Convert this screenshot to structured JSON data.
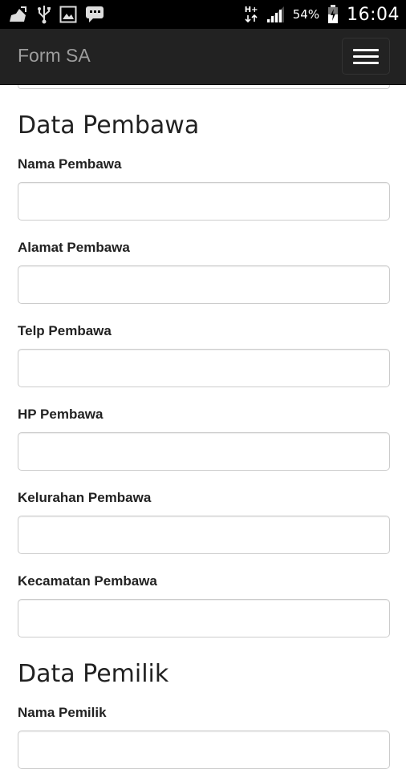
{
  "status_bar": {
    "network_type": "H+",
    "battery_percent": "54%",
    "time": "16:04"
  },
  "navbar": {
    "brand": "Form SA"
  },
  "sections": [
    {
      "title": "Data Pembawa",
      "fields": [
        {
          "label": "Nama Pembawa",
          "value": ""
        },
        {
          "label": "Alamat Pembawa",
          "value": ""
        },
        {
          "label": "Telp Pembawa",
          "value": ""
        },
        {
          "label": "HP Pembawa",
          "value": ""
        },
        {
          "label": "Kelurahan Pembawa",
          "value": ""
        },
        {
          "label": "Kecamatan Pembawa",
          "value": ""
        }
      ]
    },
    {
      "title": "Data Pemilik",
      "fields": [
        {
          "label": "Nama Pemilik",
          "value": ""
        }
      ]
    }
  ],
  "icons": {
    "status_left": [
      "app-notification-icon",
      "usb-icon",
      "image-icon",
      "chat-icon"
    ],
    "status_right": [
      "data-transfer-icon",
      "signal-icon",
      "battery-icon"
    ],
    "nav": [
      "hamburger-menu-icon"
    ]
  },
  "colors": {
    "status_bar_bg": "#000000",
    "navbar_bg": "#222222",
    "brand_text": "#9d9d9d",
    "input_border": "#cccccc"
  }
}
